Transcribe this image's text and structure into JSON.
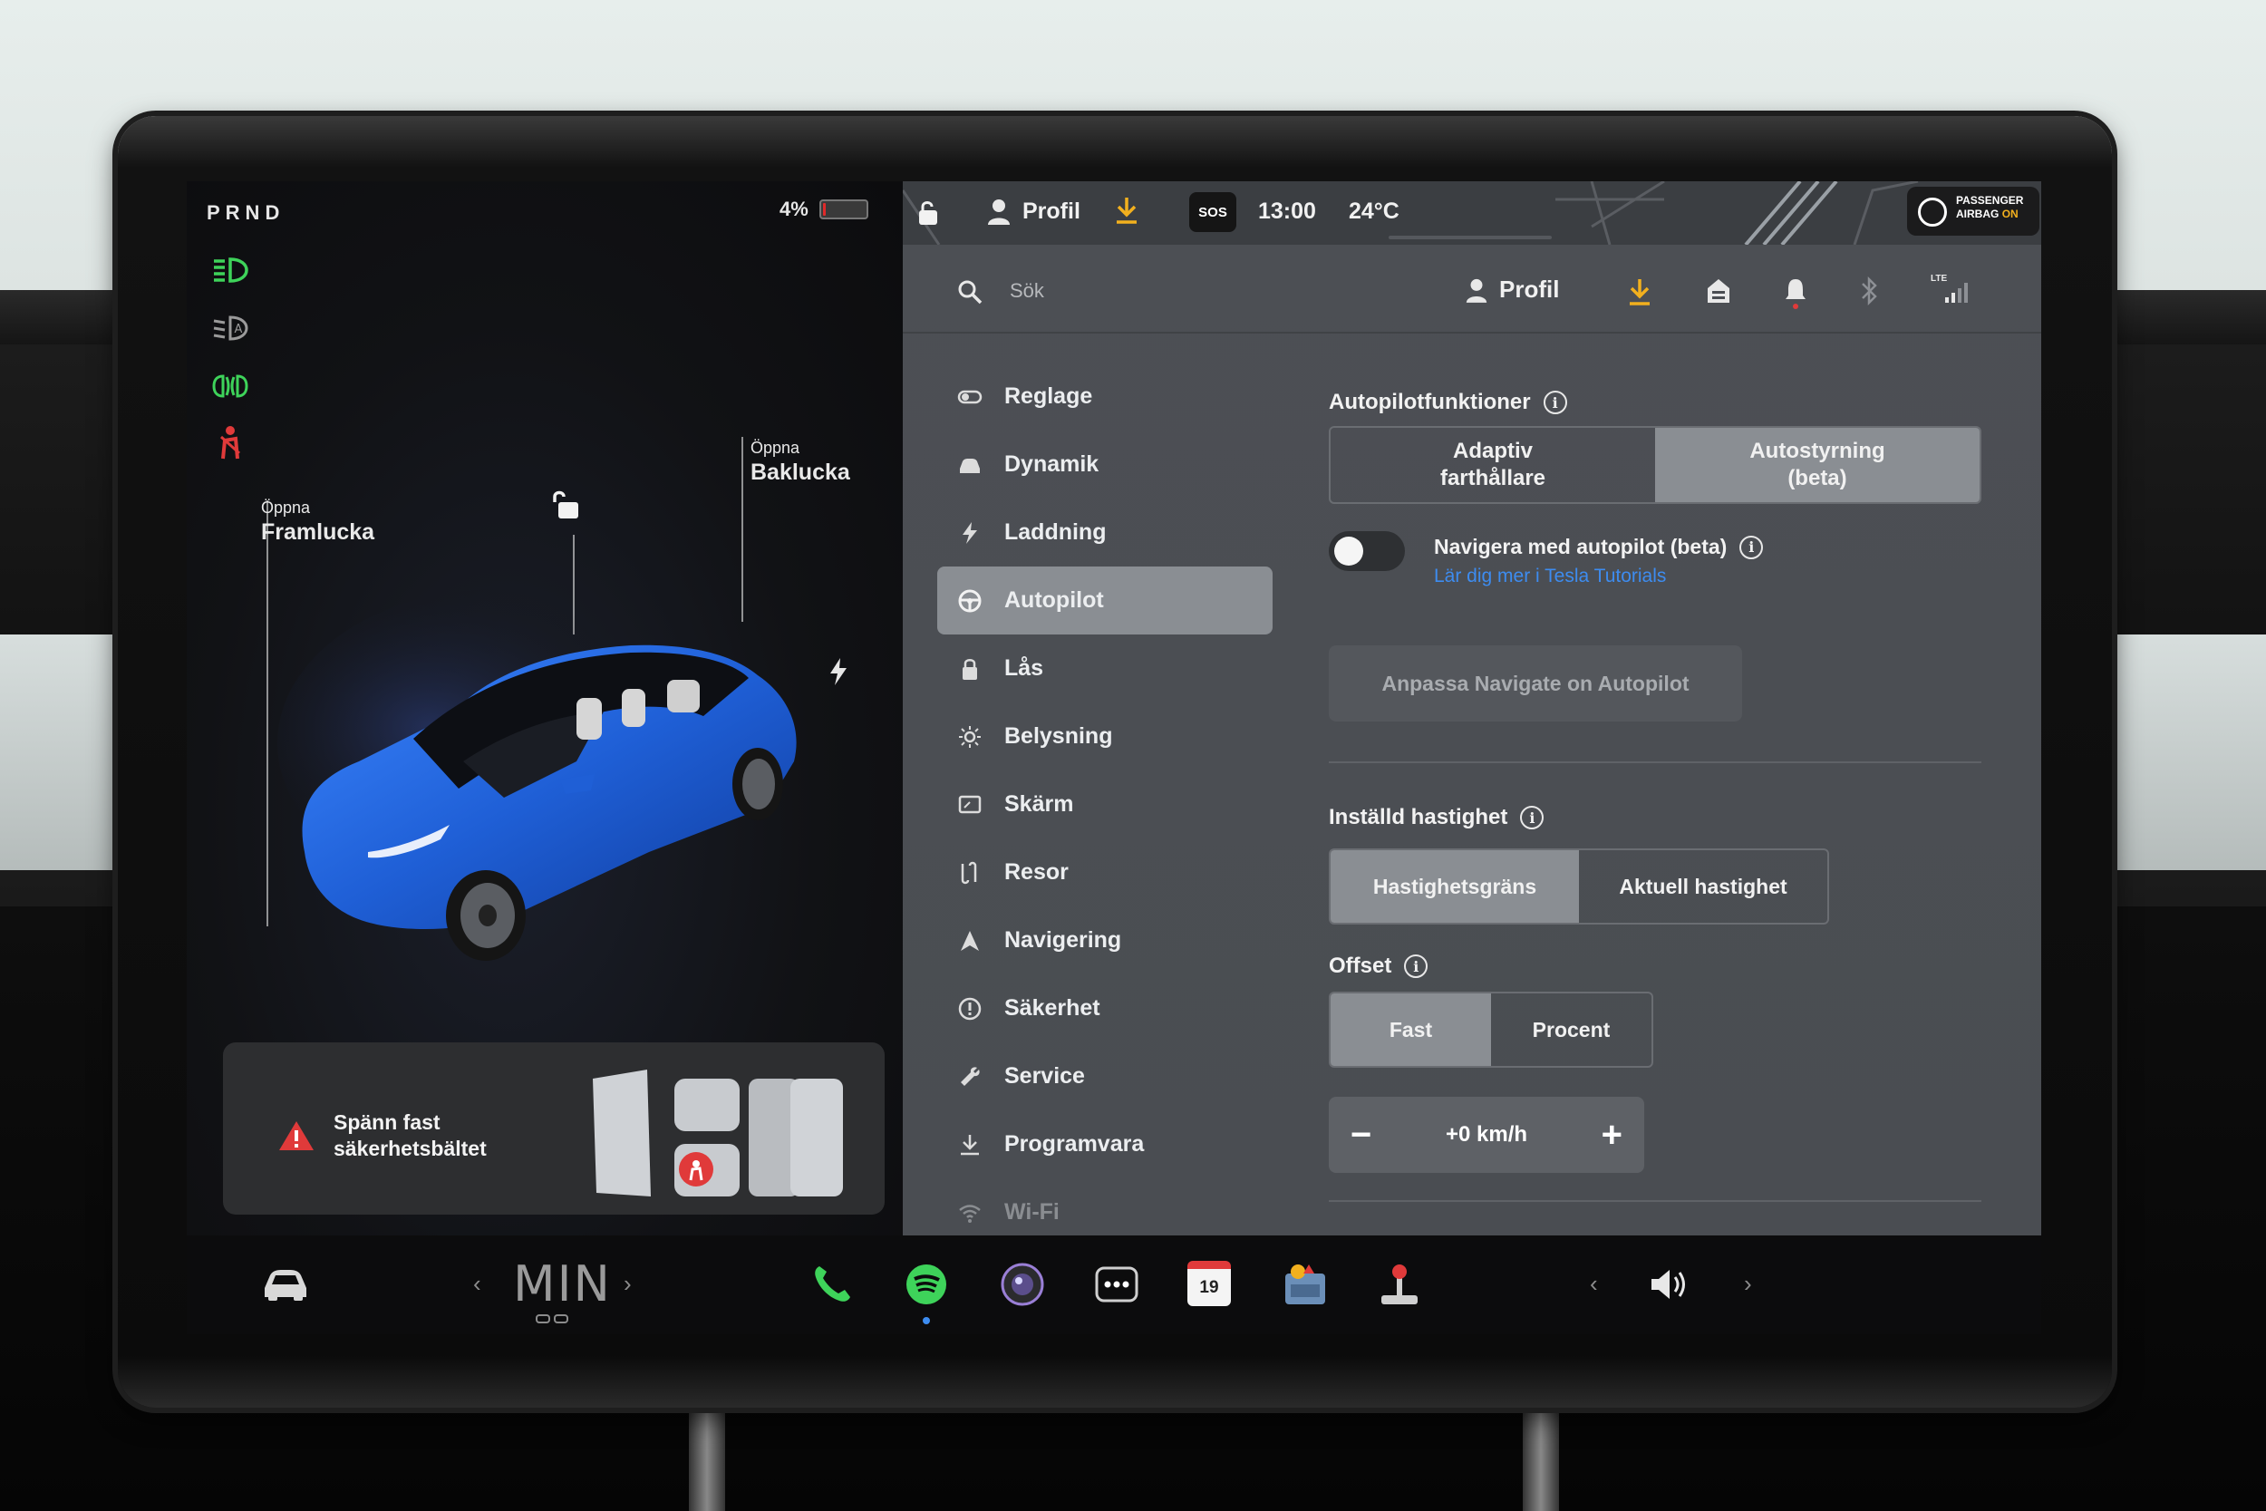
{
  "left_panel": {
    "gear": "PRND",
    "battery_percent": "4%",
    "battery_level": 0.04,
    "front_trunk": {
      "action": "Öppna",
      "label": "Framlucka"
    },
    "rear_trunk": {
      "action": "Öppna",
      "label": "Baklucka"
    },
    "icons": [
      "headlights-icon",
      "auto-headlights-icon",
      "fog-lights-icon",
      "seatbelt-warning-icon",
      "unlock-icon",
      "charge-port-icon"
    ],
    "alert": {
      "text_line1": "Spänn fast",
      "text_line2": "säkerhetsbältet"
    }
  },
  "status_bar": {
    "profile_label": "Profil",
    "sos": "SOS",
    "time": "13:00",
    "temperature": "24°C",
    "airbag_line1": "PASSENGER",
    "airbag_line2": "AIRBAG",
    "airbag_state": "ON"
  },
  "toolbar": {
    "search_placeholder": "Sök",
    "profile_label": "Profil",
    "network": "LTE"
  },
  "nav": {
    "items": [
      {
        "label": "Reglage",
        "icon": "toggle-icon"
      },
      {
        "label": "Dynamik",
        "icon": "car-icon"
      },
      {
        "label": "Laddning",
        "icon": "lightning-icon"
      },
      {
        "label": "Autopilot",
        "icon": "steering-wheel-icon",
        "active": true
      },
      {
        "label": "Lås",
        "icon": "lock-icon"
      },
      {
        "label": "Belysning",
        "icon": "sun-icon"
      },
      {
        "label": "Skärm",
        "icon": "display-icon"
      },
      {
        "label": "Resor",
        "icon": "trips-icon"
      },
      {
        "label": "Navigering",
        "icon": "navigation-arrow-icon"
      },
      {
        "label": "Säkerhet",
        "icon": "safety-icon"
      },
      {
        "label": "Service",
        "icon": "wrench-icon"
      },
      {
        "label": "Programvara",
        "icon": "download-icon"
      },
      {
        "label": "Wi-Fi",
        "icon": "wifi-icon"
      }
    ]
  },
  "autopilot": {
    "features_title": "Autopilotfunktioner",
    "features_options": [
      "Adaptiv farthållare",
      "Autostyrning (beta)"
    ],
    "features_option1_line1": "Adaptiv",
    "features_option1_line2": "farthållare",
    "features_option2_line1": "Autostyrning",
    "features_option2_line2": "(beta)",
    "features_selected": "Autostyrning (beta)",
    "nav_on_autopilot_label": "Navigera med autopilot (beta)",
    "nav_on_autopilot_enabled": false,
    "learn_more_link": "Lär dig mer i Tesla Tutorials",
    "customize_button": "Anpassa Navigate on Autopilot",
    "set_speed_title": "Inställd hastighet",
    "set_speed_options": [
      "Hastighetsgräns",
      "Aktuell hastighet"
    ],
    "set_speed_option1": "Hastighetsgräns",
    "set_speed_option2": "Aktuell hastighet",
    "set_speed_selected": "Hastighetsgräns",
    "offset_title": "Offset",
    "offset_option1": "Fast",
    "offset_option2": "Procent",
    "offset_selected": "Fast",
    "offset_value": "+0 km/h",
    "minus": "−",
    "plus": "+"
  },
  "dock": {
    "climate_temp": "MIN",
    "calendar_day": "19",
    "apps": [
      "car-icon",
      "phone-icon",
      "spotify-icon",
      "camera-icon",
      "more-apps-icon",
      "calendar-icon",
      "toybox-icon",
      "joystick-icon",
      "volume-icon"
    ]
  },
  "colors": {
    "accent_green": "#3ed35a",
    "warning_red": "#e03a3a",
    "link_blue": "#3d8cf0",
    "airbag_on": "#f2b01e",
    "car_blue": "#1f5fd6"
  }
}
